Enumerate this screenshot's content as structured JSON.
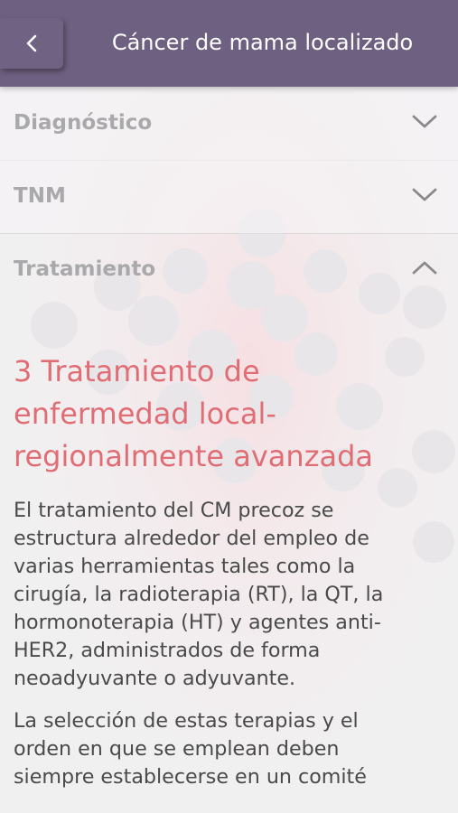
{
  "header": {
    "title": "Cáncer de mama localizado",
    "back_icon": "chevron-left-icon"
  },
  "sections": [
    {
      "label": "Diagnóstico",
      "state": "collapsed",
      "icon": "chevron-down-icon"
    },
    {
      "label": "TNM",
      "state": "collapsed",
      "icon": "chevron-down-icon"
    },
    {
      "label": "Tratamiento",
      "state": "expanded",
      "icon": "chevron-up-icon"
    }
  ],
  "content": {
    "heading_lines": [
      "3 Tratamiento de",
      "enfermedad local-",
      "regionalmente avanzada"
    ],
    "paragraph1_lines": [
      "El tratamiento del CM precoz se",
      "estructura alrededor del empleo de",
      "varias herramientas tales como la",
      "cirugía, la radioterapia (RT), la QT, la",
      "hormonoterapia (HT) y agentes anti-",
      "HER2, administrados de forma",
      "neoadyuvante o adyuvante."
    ],
    "paragraph2_lines": [
      "La selección de estas terapias y el",
      "orden en que se emplean deben",
      "siempre establecerse en un comité"
    ]
  },
  "colors": {
    "header_bg": "#6d6080",
    "heading": "#e06d74",
    "section_label": "#a9a8ab",
    "body_text": "#4a4a4a",
    "background": "#f1f0f1"
  }
}
